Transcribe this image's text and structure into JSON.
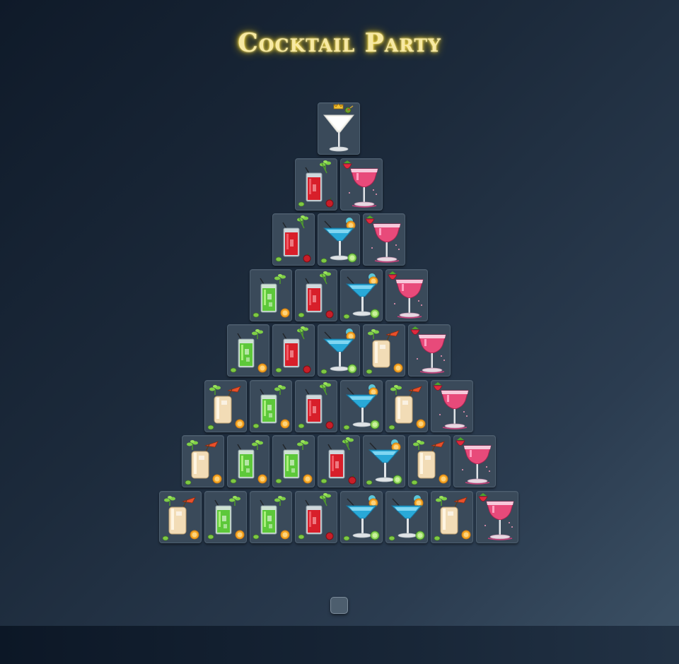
{
  "title": "Cocktail Party",
  "card_types": {
    "martini": "martini-glass-with-crown-and-olive",
    "bloody": "red-highball-with-mint-and-cherry",
    "cosmo": "pink-coupe-with-strawberry",
    "blue": "blue-margarita-glass-with-orange-and-lime",
    "mojito": "green-highball-with-mint-and-orange",
    "pina": "pina-colada-with-umbrella-and-orange"
  },
  "rows": [
    [
      "martini"
    ],
    [
      "bloody",
      "cosmo"
    ],
    [
      "bloody",
      "blue",
      "cosmo"
    ],
    [
      "mojito",
      "bloody",
      "blue",
      "cosmo"
    ],
    [
      "mojito",
      "bloody",
      "blue",
      "pina",
      "cosmo"
    ],
    [
      "pina",
      "mojito",
      "bloody",
      "blue",
      "pina",
      "cosmo"
    ],
    [
      "pina",
      "mojito",
      "mojito",
      "bloody",
      "blue",
      "pina",
      "cosmo"
    ],
    [
      "pina",
      "mojito",
      "mojito",
      "bloody",
      "blue",
      "blue",
      "pina",
      "cosmo"
    ]
  ],
  "colors": {
    "title_glow": "#ffe34d",
    "card_face": "#3a4a5a",
    "bloody_drink": "#d81f2a",
    "cosmo_drink": "#e84a7a",
    "blue_drink": "#29a9d8",
    "mojito_drink": "#5dc83a",
    "pina_drink": "#f2dcb6"
  }
}
